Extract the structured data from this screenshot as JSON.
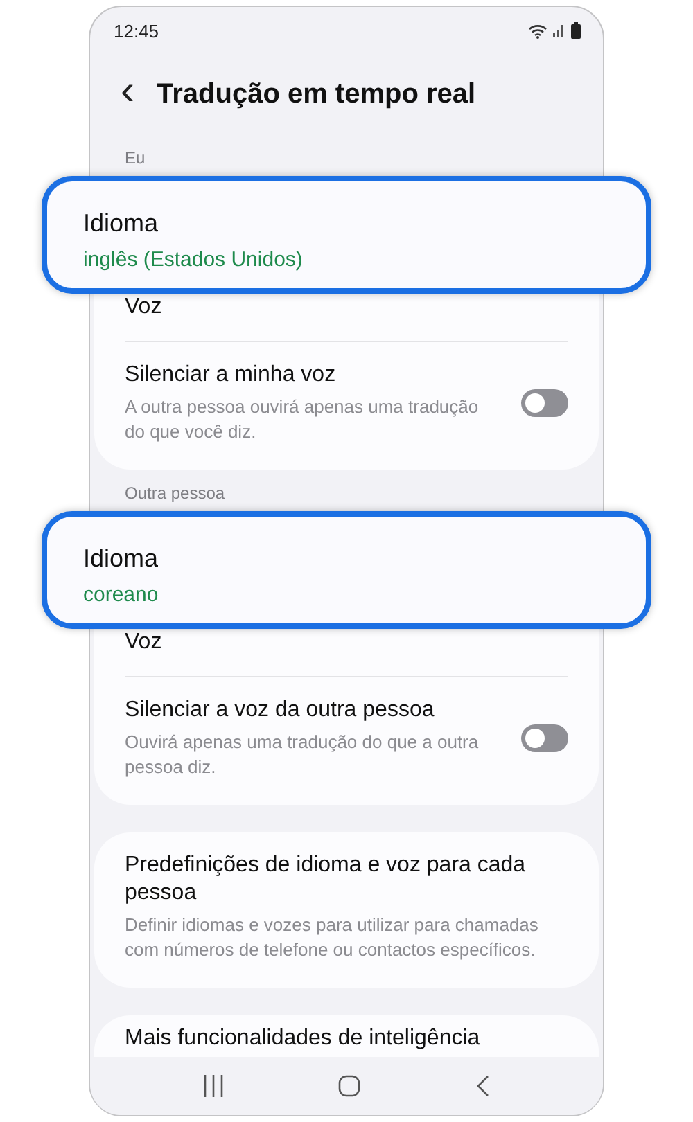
{
  "status_bar": {
    "time": "12:45"
  },
  "header": {
    "back_icon": "‹",
    "title": "Tradução em tempo real"
  },
  "sections": [
    {
      "label": "Eu",
      "items": [
        {
          "kind": "value",
          "title": "Idioma",
          "value": "inglês (Estados Unidos)",
          "highlighted": true
        },
        {
          "kind": "link",
          "title": "Voz"
        },
        {
          "kind": "switch",
          "title": "Silenciar a minha voz",
          "subtitle": "A outra pessoa ouvirá apenas uma tradução do que você diz.",
          "on": false
        }
      ]
    },
    {
      "label": "Outra pessoa",
      "items": [
        {
          "kind": "value",
          "title": "Idioma",
          "value": "coreano",
          "highlighted": true
        },
        {
          "kind": "link",
          "title": "Voz"
        },
        {
          "kind": "switch",
          "title": "Silenciar a voz da outra pessoa",
          "subtitle": "Ouvirá apenas uma tradução do que a outra pessoa diz.",
          "on": false
        }
      ]
    },
    {
      "items": [
        {
          "kind": "link",
          "title": "Predefinições de idioma e voz para cada pessoa",
          "subtitle": "Definir idiomas e vozes para utilizar para chamadas com números de telefone ou contactos específicos."
        }
      ]
    },
    {
      "items": [
        {
          "kind": "link",
          "title": "Mais funcionalidades de inteligência"
        }
      ]
    }
  ]
}
